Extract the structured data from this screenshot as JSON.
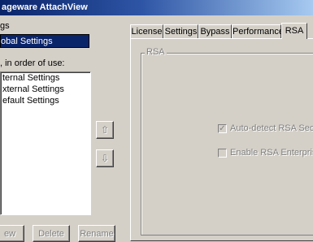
{
  "window": {
    "title": "ageware AttachView"
  },
  "left": {
    "group_label": "gs",
    "selected_profile": "obal Settings",
    "order_label": ", in order of use:",
    "order_items": [
      "ternal Settings",
      "xternal Settings",
      "efault Settings"
    ],
    "move_up_glyph": "⇧",
    "move_down_glyph": "⇩",
    "buttons": {
      "new": "ew",
      "delete": "Delete",
      "rename": "Rename"
    }
  },
  "tabs": [
    "License",
    "Settings",
    "Bypass",
    "Performance",
    "RSA"
  ],
  "active_tab": "RSA",
  "rsa": {
    "group_title": "RSA",
    "autodetect_label": "Auto-detect RSA SecurID",
    "autodetect_checked": true,
    "enable_label": "Enable RSA Enterprise S",
    "enable_checked": false
  }
}
